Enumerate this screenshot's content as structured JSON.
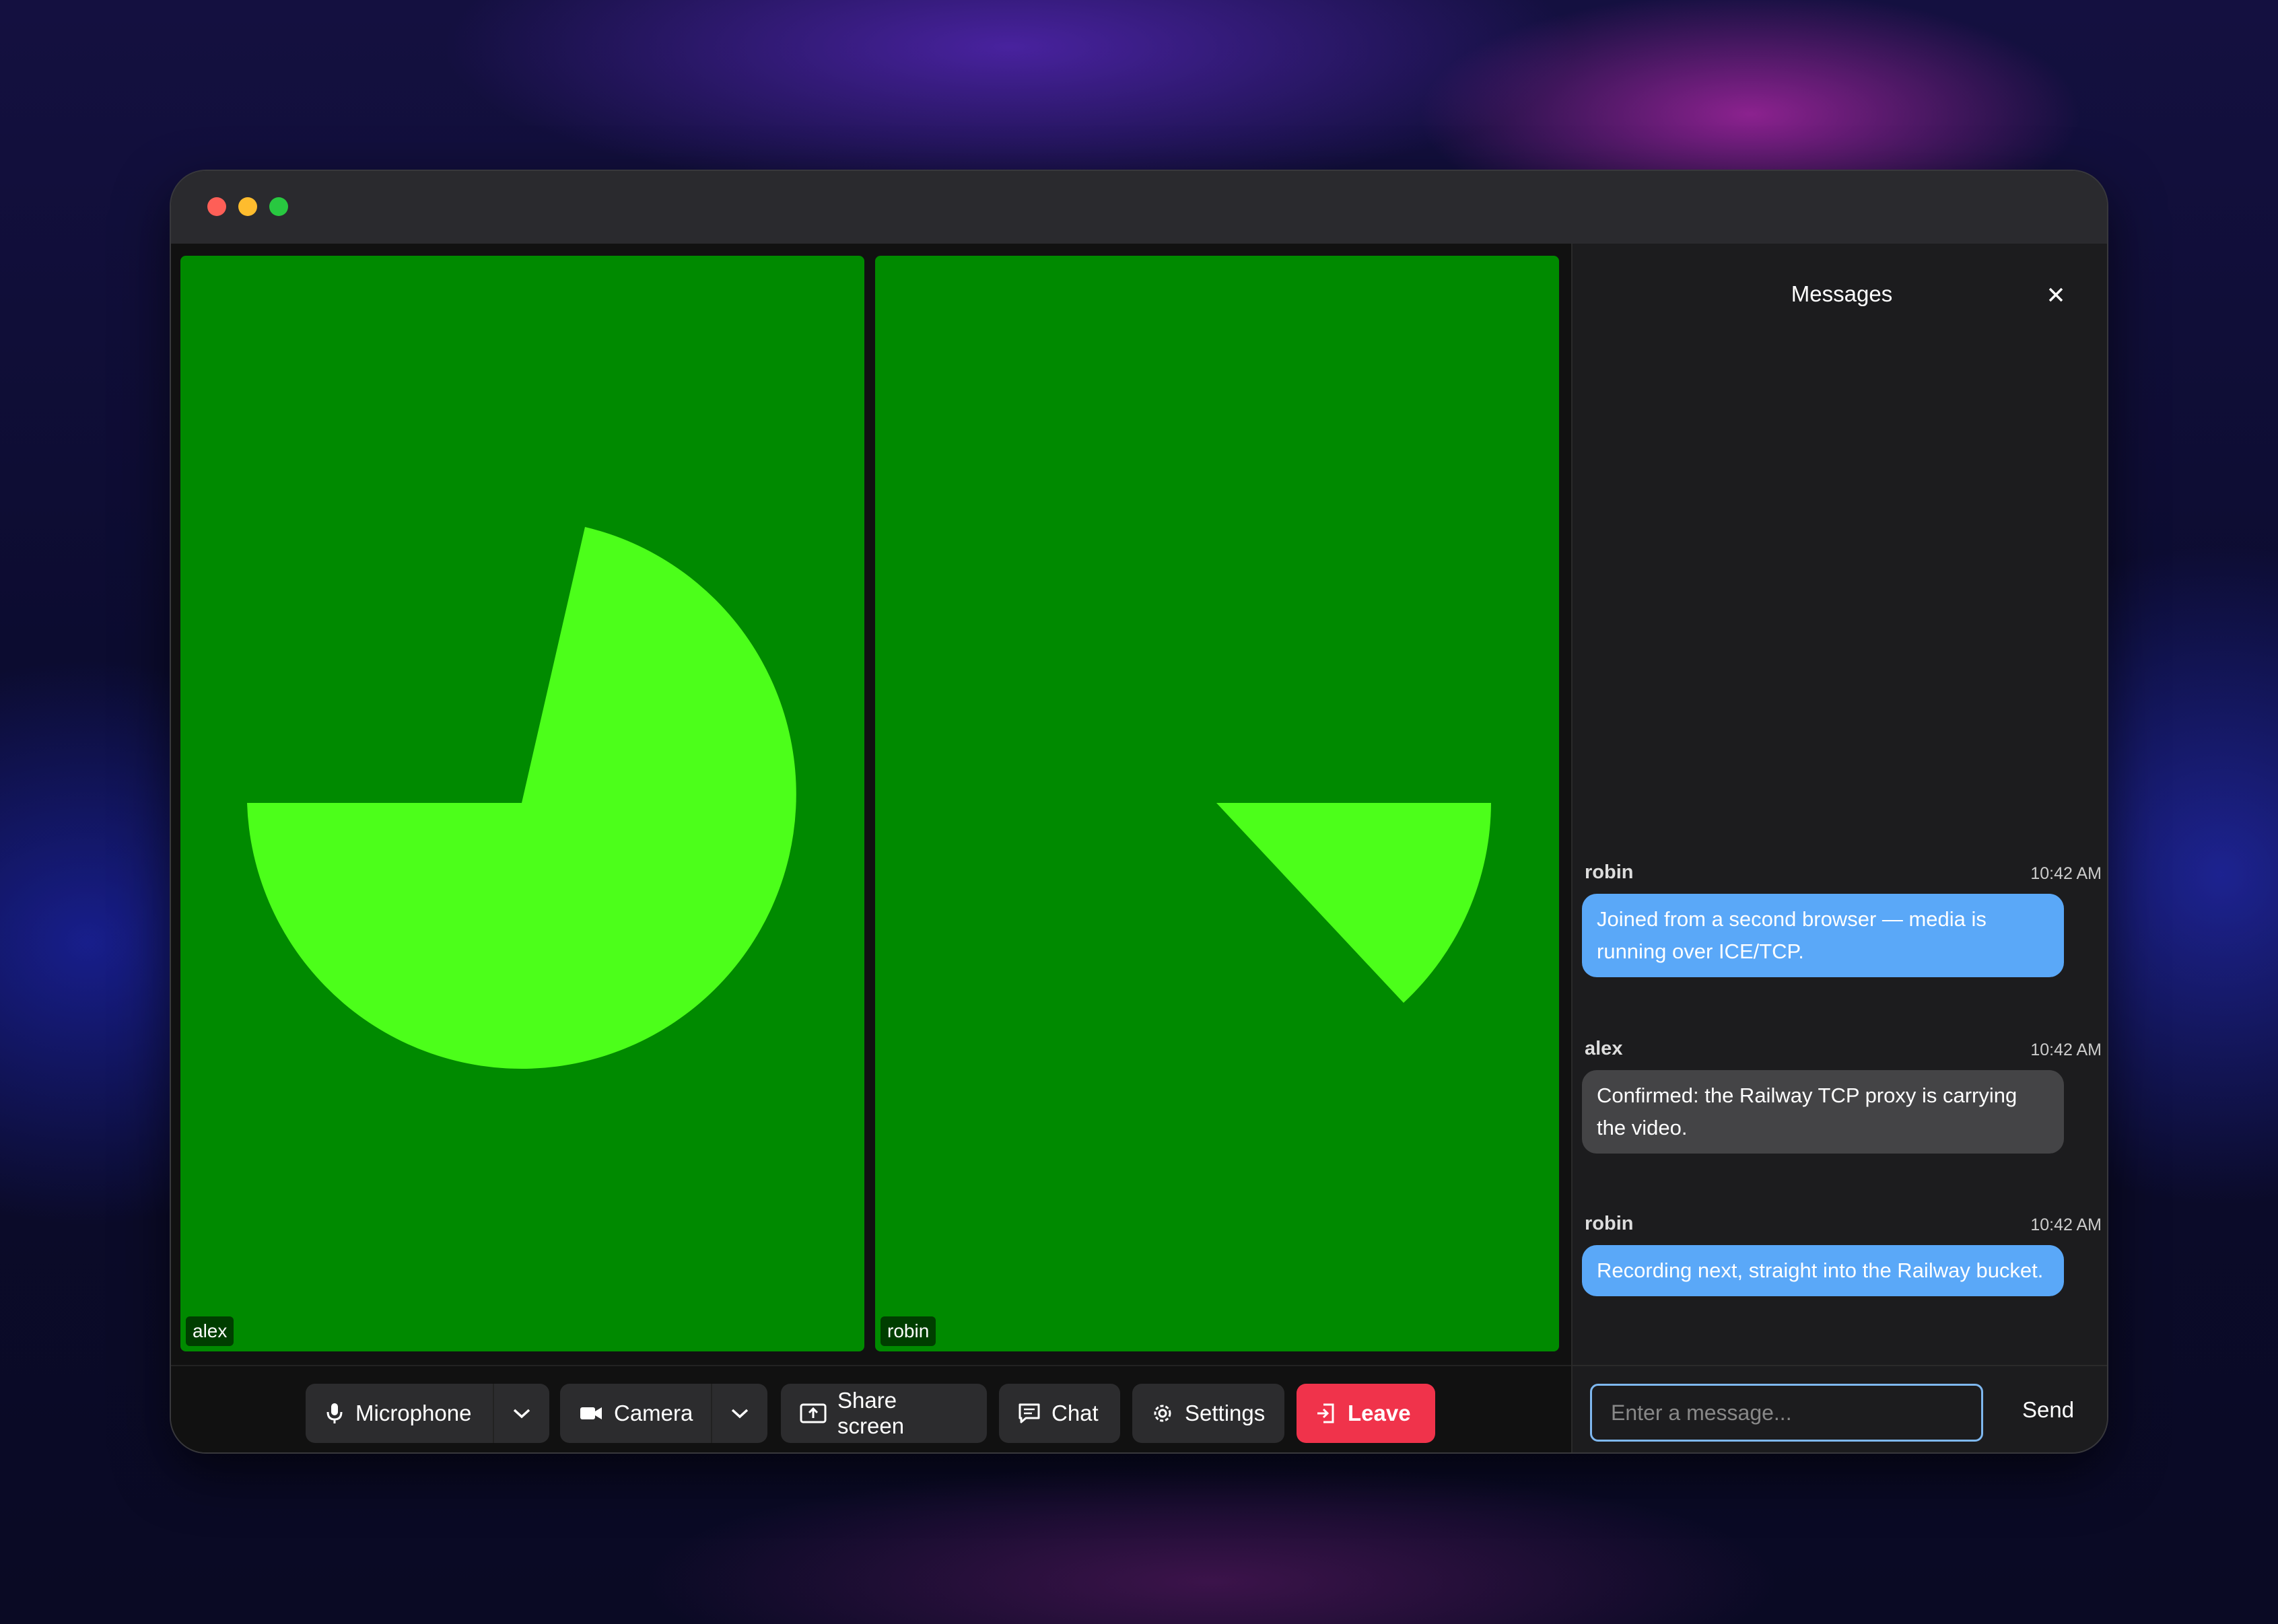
{
  "window": {
    "traffic_lights": [
      "close",
      "minimize",
      "maximize"
    ]
  },
  "participants": [
    {
      "name": "alex"
    },
    {
      "name": "robin"
    }
  ],
  "toolbar": {
    "microphone_label": "Microphone",
    "camera_label": "Camera",
    "share_screen_label": "Share screen",
    "chat_label": "Chat",
    "settings_label": "Settings",
    "leave_label": "Leave"
  },
  "chat": {
    "title": "Messages",
    "messages": [
      {
        "author": "robin",
        "time": "10:42 AM",
        "text": "Joined from a second browser — media is running over ICE/TCP."
      },
      {
        "author": "alex",
        "time": "10:42 AM",
        "text": "Confirmed: the Railway TCP proxy is carrying the video."
      },
      {
        "author": "robin",
        "time": "10:42 AM",
        "text": "Recording next, straight into the Railway bucket."
      }
    ],
    "input_placeholder": "Enter a message...",
    "send_label": "Send"
  },
  "colors": {
    "video_background": "#008a00",
    "video_shape": "#4cff1a",
    "own_bubble": "#5aa8f8",
    "other_bubble": "#444446",
    "leave_button": "#f0334b"
  }
}
